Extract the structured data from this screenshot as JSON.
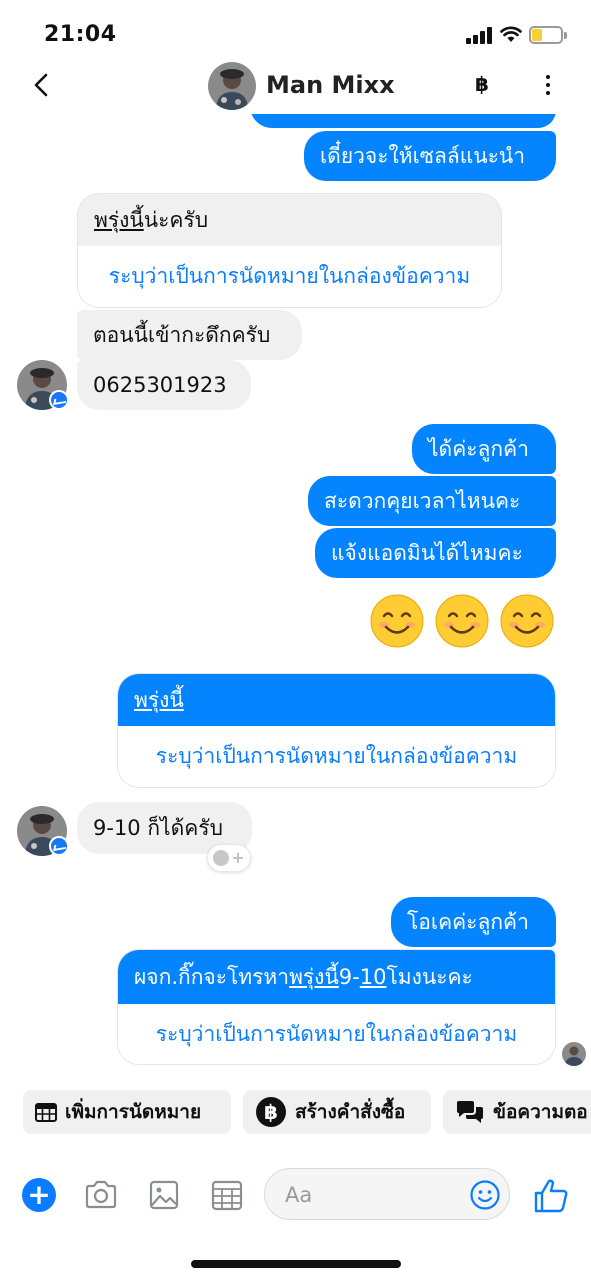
{
  "status_bar": {
    "time": "21:04"
  },
  "header": {
    "contact_name": "Man Mixx",
    "currency_symbol": "฿"
  },
  "messages": {
    "m1": "เดี๋ยวจะให้เซลล์แนะนำ",
    "card1": {
      "top_underlined": "พรุ่งนี้",
      "top_rest": "น่ะครับ",
      "action": "ระบุว่าเป็นการนัดหมายในกล่องข้อความ"
    },
    "m2": "ตอนนี้เข้ากะดึกครับ",
    "m3": "0625301923",
    "m4": "ได้ค่ะลูกค้า",
    "m5": "สะดวกคุยเวลาไหนคะ",
    "m6": "แจ้งแอดมินได้ไหมคะ",
    "emoji_row": "😊😊😊",
    "card2": {
      "top_underlined": "พรุ่งนี้",
      "action": "ระบุว่าเป็นการนัดหมายในกล่องข้อความ"
    },
    "m7": "9-10 ก็ได้ครับ",
    "m8": "โอเคค่ะลูกค้า",
    "card3": {
      "top_pre": "ผจก.กิ๊กจะโทรหา",
      "top_u1": "พรุ่งนี้",
      "top_mid": "9-",
      "top_u2": "10",
      "top_post": "โมงนะคะ",
      "action": "ระบุว่าเป็นการนัดหมายในกล่องข้อความ"
    }
  },
  "quick_replies": {
    "appointment": "เพิ่มการนัดหมาย",
    "order": "สร้างคำสั่งซื้อ",
    "reply": "ข้อความตอ"
  },
  "composer": {
    "placeholder": "Aa"
  },
  "colors": {
    "accent": "#0584ff",
    "incoming": "#f0f0f0",
    "link": "#0a7cff"
  }
}
